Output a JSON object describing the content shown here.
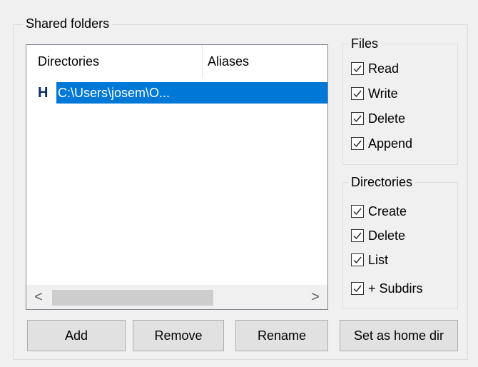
{
  "shared_folders": {
    "title": "Shared folders",
    "list": {
      "columns": [
        "Directories",
        "Aliases"
      ],
      "rows": [
        {
          "icon_letter": "H",
          "directory": "C:\\Users\\josem\\O...",
          "alias": "",
          "selected": true
        }
      ],
      "scrollbar": {
        "left_arrow": "<",
        "right_arrow": ">"
      }
    },
    "files": {
      "title": "Files",
      "options": [
        {
          "label": "Read",
          "checked": true
        },
        {
          "label": "Write",
          "checked": true
        },
        {
          "label": "Delete",
          "checked": true
        },
        {
          "label": "Append",
          "checked": true
        }
      ]
    },
    "directories": {
      "title": "Directories",
      "options": [
        {
          "label": "Create",
          "checked": true
        },
        {
          "label": "Delete",
          "checked": true
        },
        {
          "label": "List",
          "checked": true
        },
        {
          "label": "+ Subdirs",
          "checked": true
        }
      ]
    },
    "buttons": {
      "add": "Add",
      "remove": "Remove",
      "rename": "Rename",
      "set_home": "Set as home dir"
    }
  },
  "colors": {
    "selection": "#0078d7",
    "home_icon": "#0c2f6b"
  }
}
